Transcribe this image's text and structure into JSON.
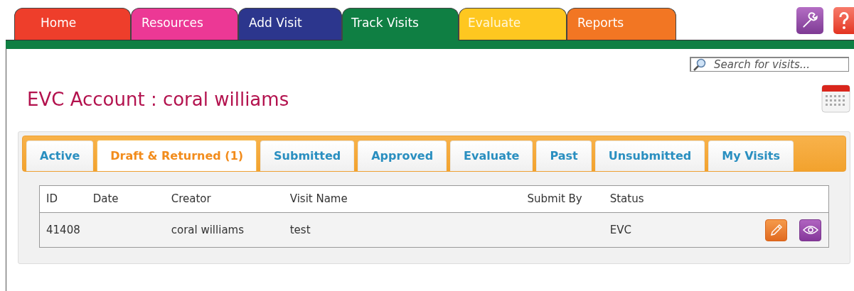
{
  "nav_tabs": [
    {
      "label": "Home",
      "color": "#ee3e2b",
      "selected": false
    },
    {
      "label": "Resources",
      "color": "#ec3895",
      "selected": false
    },
    {
      "label": "Add Visit",
      "color": "#2c368d",
      "selected": false
    },
    {
      "label": "Track Visits",
      "color": "#0f7f43",
      "selected": true
    },
    {
      "label": "Evaluate",
      "color": "#fec720",
      "selected": false
    },
    {
      "label": "Reports",
      "color": "#f27623",
      "selected": false
    }
  ],
  "search": {
    "placeholder": "Search for visits..."
  },
  "heading": "EVC Account : coral williams",
  "visit_tabs": [
    {
      "label": "Active",
      "selected": false
    },
    {
      "label": "Draft & Returned (1)",
      "selected": true
    },
    {
      "label": "Submitted",
      "selected": false
    },
    {
      "label": "Approved",
      "selected": false
    },
    {
      "label": "Evaluate",
      "selected": false
    },
    {
      "label": "Past",
      "selected": false
    },
    {
      "label": "Unsubmitted",
      "selected": false
    },
    {
      "label": "My Visits",
      "selected": false
    }
  ],
  "table": {
    "columns": [
      "ID",
      "Date",
      "Creator",
      "Visit Name",
      "Submit By",
      "Status"
    ],
    "rows": [
      {
        "cells": [
          "41408",
          "",
          "coral williams",
          "test",
          "",
          "EVC"
        ]
      }
    ]
  }
}
